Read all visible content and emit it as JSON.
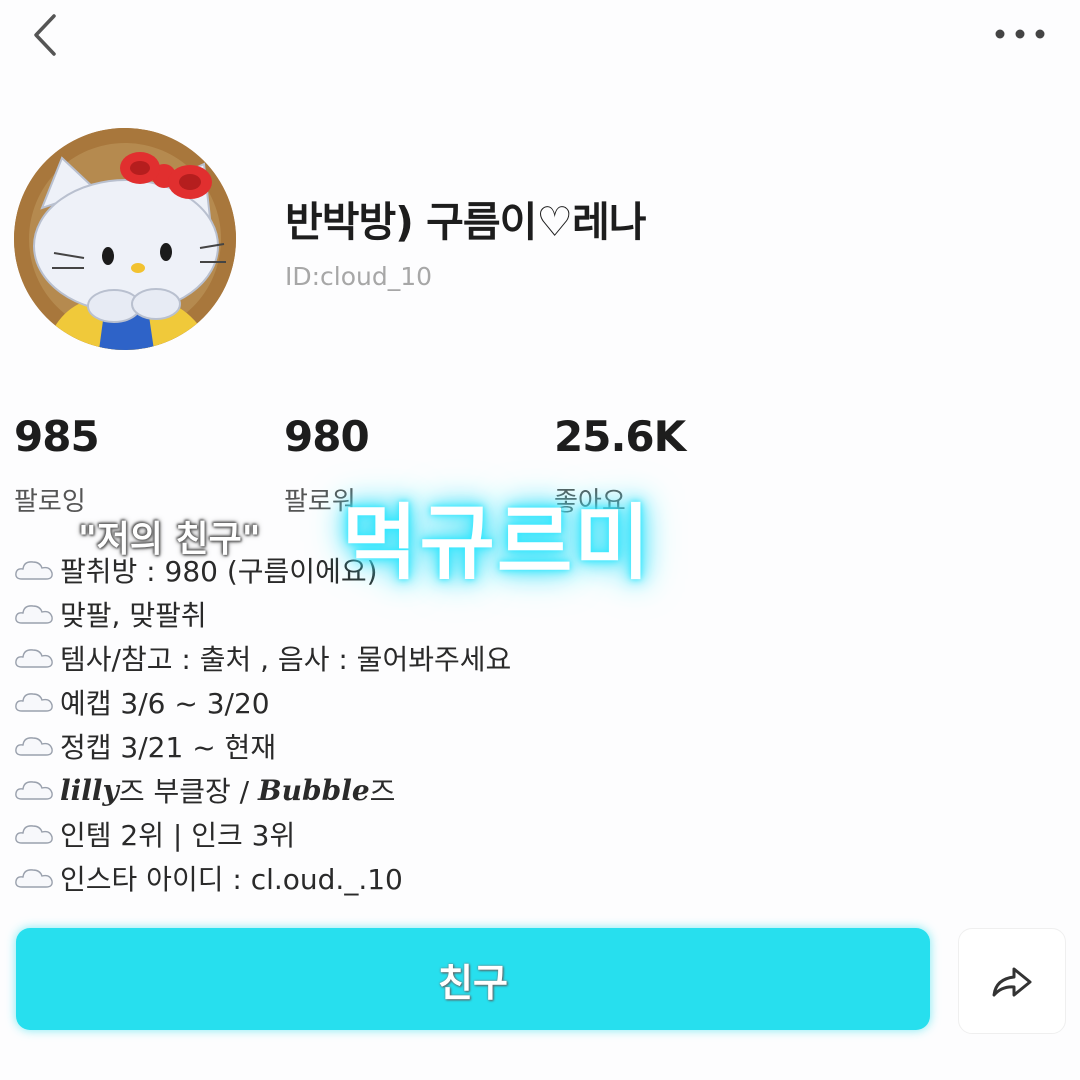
{
  "header": {
    "back_icon": "chevron-left-icon",
    "more_icon": "more-horizontal-icon"
  },
  "profile": {
    "avatar_icon": "hello-kitty-avatar",
    "nickname": "반박방) 구름이♡레나",
    "user_id": "ID:cloud_10"
  },
  "stats": [
    {
      "value": "985",
      "label": "팔로잉"
    },
    {
      "value": "980",
      "label": "팔로워"
    },
    {
      "value": "25.6K",
      "label": "좋아요"
    }
  ],
  "overlay": {
    "caption": "\"저의 친구\"",
    "neon_name": "먹규르미",
    "neon_color": "#2ee7ff"
  },
  "bio": {
    "bullet_icon": "cloud-icon",
    "lines": [
      {
        "text": "팔취방 : 980 (구름이에요)"
      },
      {
        "text": "맞팔, 맞팔취"
      },
      {
        "text": "템사/참고 : 출처 , 음사 : 물어봐주세요"
      },
      {
        "text": "예캡 3/6 ~ 3/20"
      },
      {
        "text": "정캡 3/21 ~ 현재"
      },
      {
        "script_a": "lilly",
        "text_a": "즈 부클장 / ",
        "script_b": "Bubble",
        "text_b": "즈"
      },
      {
        "text": "인템 2위 | 인크 3위"
      },
      {
        "text": "인스타 아이디 : cl.oud._.10"
      }
    ]
  },
  "actions": {
    "friend_label": "친구",
    "friend_color": "#27dfee",
    "share_icon": "share-arrow-icon"
  }
}
